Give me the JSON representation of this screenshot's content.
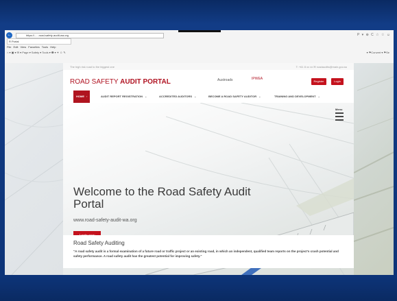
{
  "browser": {
    "address": "https://......road-safety-audit-wa.org",
    "address_right": "P ▾ ⊕ C ☆ ☆ ☺",
    "tab_label": "R Portal",
    "menu": "File  Edit  View  Favorites  Tools  Help",
    "command_bar": "⌂ ▾ ▣ ▾ ✉ ▾ Page ▾  Safety ▾  Tools ▾  ❶ ▾  ✦ ☺ ✎",
    "favorites_right": "▾ ⚑Convert ▾ ⚑Se"
  },
  "site": {
    "tagline": "The high risk road to the biggest one",
    "contact": "T: +61 8 xx xx  ✉ roadaudits@main.gov.au",
    "logo_prefix": "ROAD SAFETY ",
    "logo_bold": "AUDIT PORTAL",
    "partner1": "Austroads",
    "partner2": "IPWEA",
    "register_label": "Register",
    "login_label": "Login",
    "nav": [
      {
        "label": "HOME"
      },
      {
        "label": "AUDIT REPORT REGISTRATION"
      },
      {
        "label": "ACCREDITED AUDITORS"
      },
      {
        "label": "BECOME A ROAD SAFETY AUDITOR"
      },
      {
        "label": "TRAINING AND DEVELOPMENT"
      }
    ],
    "menu_label": "Menu"
  },
  "hero": {
    "title": "Welcome to the Road Safety Audit Portal",
    "url": "www.road-safety-audit-wa.org",
    "cta": "Login now"
  },
  "section": {
    "title": "Road Safety Auditing",
    "body": "\"A road safety audit is a formal examination of a future road or traffic project or an existing road, in which an independent, qualified team reports on the project's crash potential and safety performance. A road safety audit has the greatest potential for improving safety.\""
  },
  "colors": {
    "brand_red": "#c4121d",
    "slide_blue": "#0d3478"
  }
}
